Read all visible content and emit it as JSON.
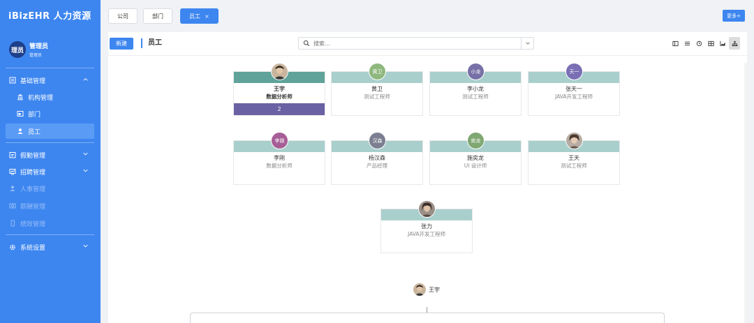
{
  "app": {
    "brand": "iBizEHR 人力资源"
  },
  "user": {
    "avatar_text": "理员",
    "name": "管理员",
    "role": "管理员"
  },
  "sidebar": {
    "groups": [
      {
        "label": "基础管理",
        "icon": "building-icon",
        "expanded": true
      },
      {
        "label": "假勤管理",
        "icon": "calendar-icon"
      },
      {
        "label": "招聘管理",
        "icon": "recruit-icon"
      },
      {
        "label": "系统设置",
        "icon": "gear-icon"
      }
    ],
    "sub_items": [
      {
        "label": "机构管理",
        "icon": "bank-icon"
      },
      {
        "label": "部门",
        "icon": "image-icon"
      },
      {
        "label": "员工",
        "icon": "person-icon",
        "active": true
      }
    ],
    "disabled_items": [
      {
        "label": "人事管理",
        "icon": "person-icon"
      },
      {
        "label": "薪酬管理",
        "icon": "money-icon"
      },
      {
        "label": "绩效管理",
        "icon": "phone-icon"
      }
    ]
  },
  "tabs": [
    {
      "label": "公司"
    },
    {
      "label": "部门"
    },
    {
      "label": "员工",
      "active": true,
      "close": "×"
    }
  ],
  "toolbar": {
    "more_label": "更多+",
    "new_label": "新建",
    "title": "员工",
    "search_placeholder": "搜索..."
  },
  "views": [
    "panel-view-icon",
    "list-view-icon",
    "clock-view-icon",
    "grid-view-icon",
    "chart-view-icon",
    "org-view-icon"
  ],
  "cards": [
    {
      "name": "王宇",
      "role": "数据分析师",
      "avatar": "photo",
      "manager": true,
      "count": "2"
    },
    {
      "name": "黄卫",
      "role": "测试工程师",
      "avatar": "黄卫",
      "color": "#8fb87e"
    },
    {
      "name": "李小龙",
      "role": "测试工程师",
      "avatar": "小龙",
      "color": "#7670a6"
    },
    {
      "name": "张天一",
      "role": "JAVA开发工程师",
      "avatar": "天一",
      "color": "#7a6fb5"
    },
    {
      "name": "李刚",
      "role": "数据分析师",
      "avatar": "李刚",
      "color": "#a65e96"
    },
    {
      "name": "杨汉森",
      "role": "产品经理",
      "avatar": "汉森",
      "color": "#7c7f91"
    },
    {
      "name": "施奕龙",
      "role": "UI 设计师",
      "avatar": "奕龙",
      "color": "#7fa772"
    },
    {
      "name": "王天",
      "role": "测试工程师",
      "avatar": "photo2"
    },
    {
      "name": "张力",
      "role": "JAVA开发工程师",
      "avatar": "photo3"
    }
  ],
  "tree": {
    "root_name": "王宇"
  },
  "colors": {
    "accent": "#3d86f0",
    "band": "#a9cfcd",
    "manager_band": "#5fa39a",
    "count_bar": "#6961a3"
  }
}
